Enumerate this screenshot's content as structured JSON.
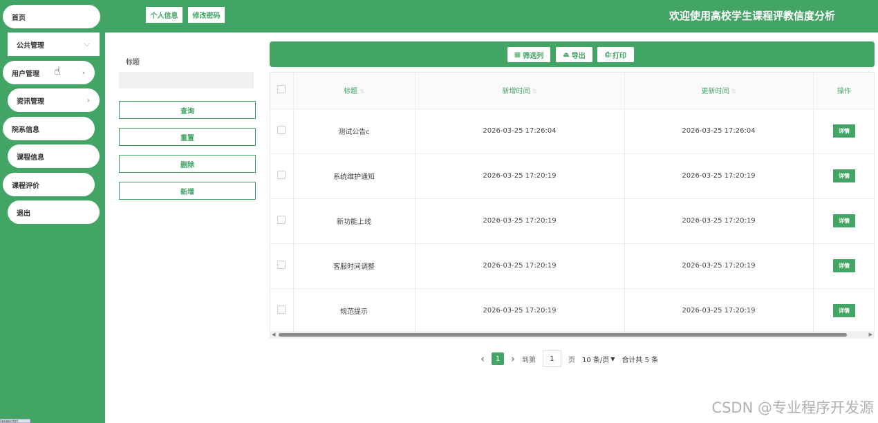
{
  "header": {
    "title": "欢迎使用高校学生课程评教信度分析",
    "profile_label": "个人信息",
    "password_label": "修改密码"
  },
  "sidebar": {
    "items": [
      {
        "label": "首页"
      },
      {
        "label": "公共管理"
      },
      {
        "label": "用户管理"
      },
      {
        "label": "资讯管理"
      },
      {
        "label": "院系信息"
      },
      {
        "label": "课程信息"
      },
      {
        "label": "课程评价"
      },
      {
        "label": "退出"
      }
    ],
    "expand_chevron": "⌵",
    "right_chevron": "›"
  },
  "filter": {
    "title_label": "标题",
    "title_value": "",
    "query_label": "查询",
    "reset_label": "重置",
    "delete_label": "删除",
    "add_label": "新增"
  },
  "toolbar": {
    "columns_label": "筛选列",
    "export_label": "导出",
    "print_label": "打印"
  },
  "table": {
    "headers": {
      "title": "标题",
      "created": "新增时间",
      "updated": "更新时间",
      "action": "操作"
    },
    "rows": [
      {
        "title": "测试公告c",
        "created": "2026-03-25 17:26:04",
        "updated": "2026-03-25 17:26:04",
        "action": "详情"
      },
      {
        "title": "系统维护通知",
        "created": "2026-03-25 17:20:19",
        "updated": "2026-03-25 17:20:19",
        "action": "详情"
      },
      {
        "title": "新功能上线",
        "created": "2026-03-25 17:20:19",
        "updated": "2026-03-25 17:20:19",
        "action": "详情"
      },
      {
        "title": "客服时间调整",
        "created": "2026-03-25 17:20:19",
        "updated": "2026-03-25 17:20:19",
        "action": "详情"
      },
      {
        "title": "规范提示",
        "created": "2026-03-25 17:20:19",
        "updated": "2026-03-25 17:20:19",
        "action": "详情"
      }
    ]
  },
  "pagination": {
    "prev": "‹",
    "current_page": "1",
    "next": "›",
    "goto_label": "到第",
    "goto_value": "1",
    "page_unit": "页",
    "page_size": "10 条/页",
    "total": "合计共 5 条"
  },
  "watermark": "CSDN @专业程序开发源",
  "tooltip": "javascript:",
  "colors": {
    "brand_green": "#42a465",
    "white": "#ffffff"
  }
}
